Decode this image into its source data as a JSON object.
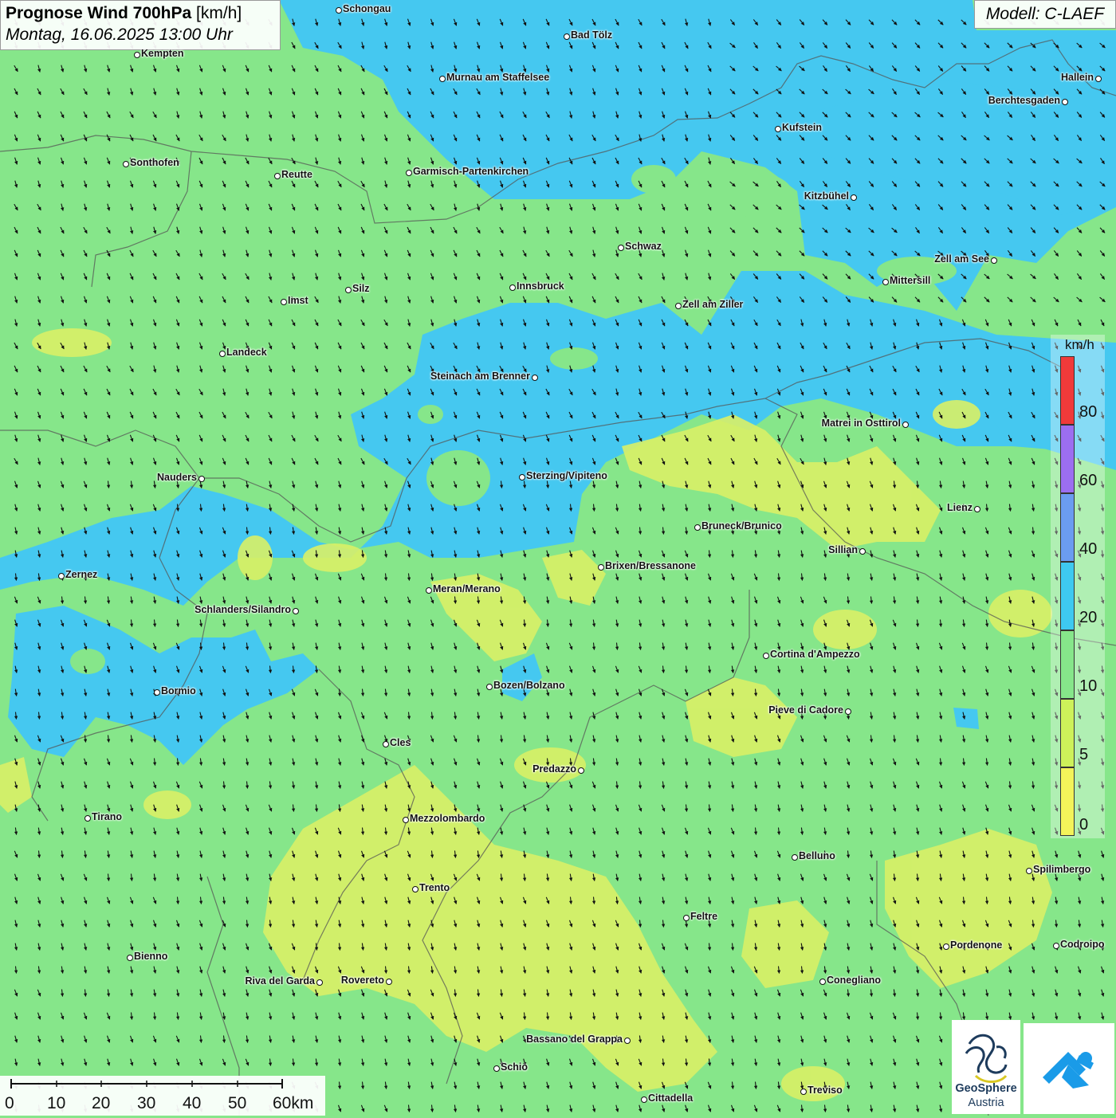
{
  "title": {
    "main": "Prognose Wind 700hPa",
    "unit": "[km/h]",
    "subtitle": "Montag, 16.06.2025 13:00 Uhr"
  },
  "model": "Modell: C-LAEF",
  "legend": {
    "unit": "km/h",
    "classes": [
      {
        "label": "80",
        "color": "#f03a3a"
      },
      {
        "label": "60",
        "color": "#9c6ef0"
      },
      {
        "label": "40",
        "color": "#6b9cf0"
      },
      {
        "label": "20",
        "color": "#3ec9f0"
      },
      {
        "label": "10",
        "color": "#86e68a"
      },
      {
        "label": "5",
        "color": "#cdf15a"
      },
      {
        "label": "0",
        "color": "#f3f35a"
      }
    ]
  },
  "scale": {
    "labels": [
      "0",
      "10",
      "20",
      "30",
      "40",
      "50",
      "60km"
    ]
  },
  "cities": [
    {
      "name": "Schongau"
    },
    {
      "name": "Bad Tölz"
    },
    {
      "name": "Kempten"
    },
    {
      "name": "Murnau am Staffelsee"
    },
    {
      "name": "Hallein"
    },
    {
      "name": "Berchtesgaden"
    },
    {
      "name": "Kufstein"
    },
    {
      "name": "Sonthofen"
    },
    {
      "name": "Reutte"
    },
    {
      "name": "Garmisch-Partenkirchen"
    },
    {
      "name": "Kitzbühel"
    },
    {
      "name": "Schwaz"
    },
    {
      "name": "Zell am See"
    },
    {
      "name": "Mittersill"
    },
    {
      "name": "Silz"
    },
    {
      "name": "Innsbruck"
    },
    {
      "name": "Imst"
    },
    {
      "name": "Zell am Ziller"
    },
    {
      "name": "Landeck"
    },
    {
      "name": "Steinach am Brenner"
    },
    {
      "name": "Matrei in Osttirol"
    },
    {
      "name": "Nauders"
    },
    {
      "name": "Sterzing/Vipiteno"
    },
    {
      "name": "Lienz"
    },
    {
      "name": "Bruneck/Brunico"
    },
    {
      "name": "Sillian"
    },
    {
      "name": "Brixen/Bressanone"
    },
    {
      "name": "Zernez"
    },
    {
      "name": "Meran/Merano"
    },
    {
      "name": "Schlanders/Silandro"
    },
    {
      "name": "Cortina d'Ampezzo"
    },
    {
      "name": "Bozen/Bolzano"
    },
    {
      "name": "Bormio"
    },
    {
      "name": "Pieve di Cadore"
    },
    {
      "name": "Cles"
    },
    {
      "name": "Predazzo"
    },
    {
      "name": "Tirano"
    },
    {
      "name": "Mezzolombardo"
    },
    {
      "name": "Belluno"
    },
    {
      "name": "Spilimbergo"
    },
    {
      "name": "Trento"
    },
    {
      "name": "Feltre"
    },
    {
      "name": "Pordenone"
    },
    {
      "name": "Codroipo"
    },
    {
      "name": "Bienno"
    },
    {
      "name": "Riva del Garda"
    },
    {
      "name": "Rovereto"
    },
    {
      "name": "Conegliano"
    },
    {
      "name": "Bassano del Grappa"
    },
    {
      "name": "Schio"
    },
    {
      "name": "Treviso"
    },
    {
      "name": "Cittadella"
    }
  ],
  "logos": {
    "geosphere_line1": "GeoSphere",
    "geosphere_line2": "Austria"
  }
}
